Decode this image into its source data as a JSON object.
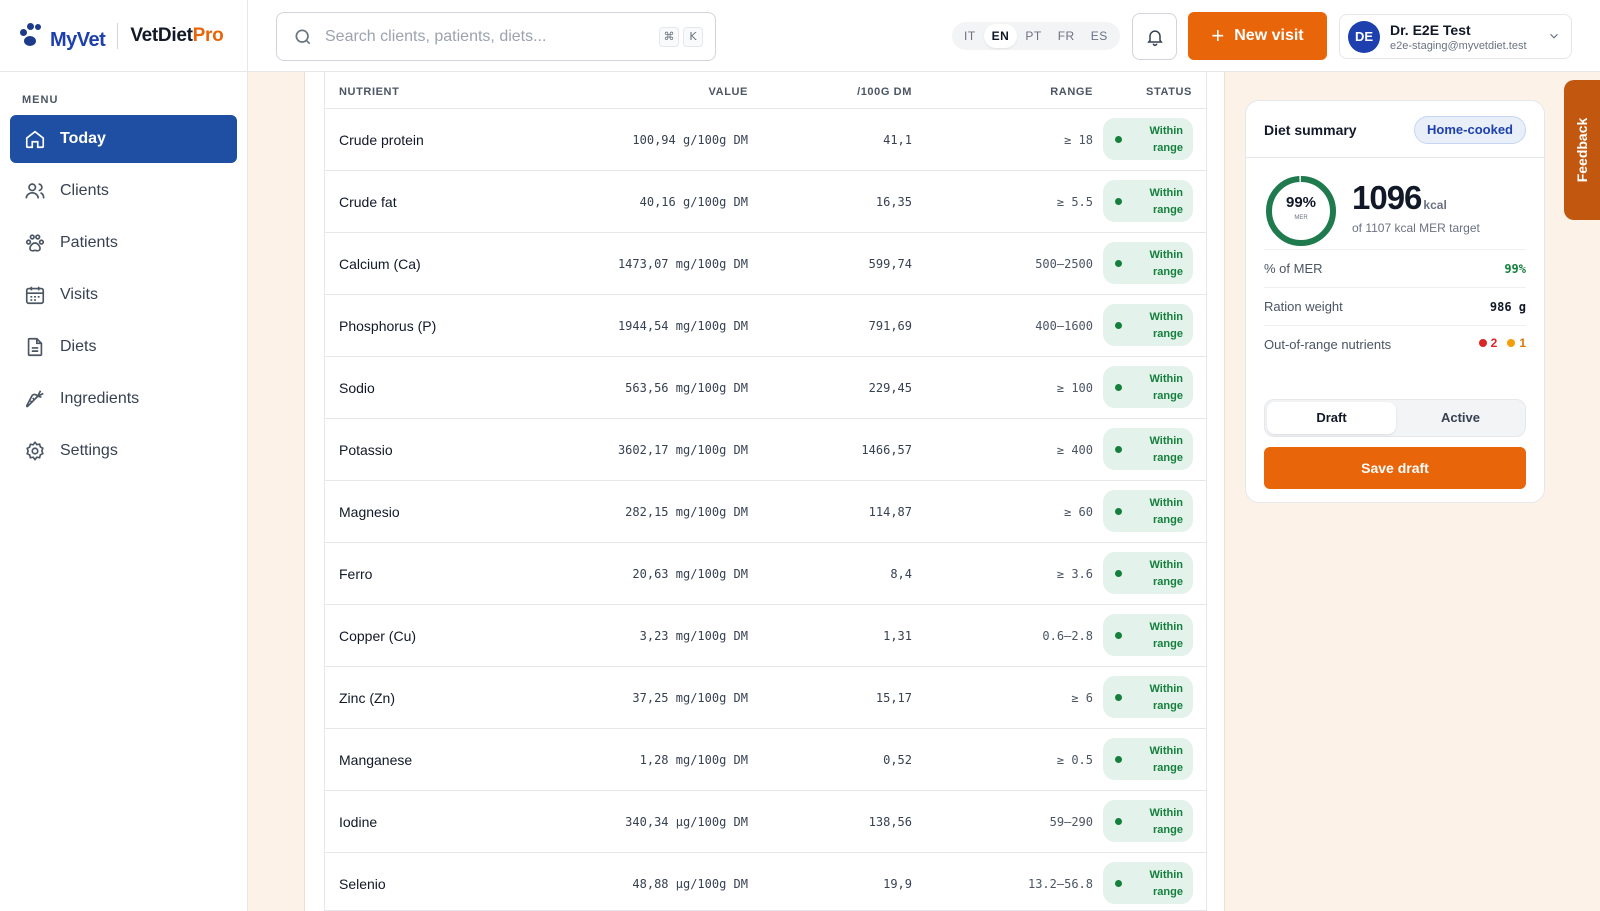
{
  "brand": {
    "logo_text": "MyVet",
    "product_main": "VetDiet",
    "product_accent": "Pro"
  },
  "search": {
    "placeholder": "Search clients, patients, diets...",
    "shortcut_1": "⌘",
    "shortcut_2": "K"
  },
  "languages": [
    {
      "code": "IT",
      "active": false
    },
    {
      "code": "EN",
      "active": true
    },
    {
      "code": "PT",
      "active": false
    },
    {
      "code": "FR",
      "active": false
    },
    {
      "code": "ES",
      "active": false
    }
  ],
  "header": {
    "new_visit_label": "New visit"
  },
  "user": {
    "initials": "DE",
    "name": "Dr. E2E Test",
    "email": "e2e-staging@myvetdiet.test"
  },
  "sidebar": {
    "menu_title": "MENU",
    "items": [
      {
        "label": "Today",
        "icon": "home-icon",
        "active": true
      },
      {
        "label": "Clients",
        "icon": "users-icon",
        "active": false
      },
      {
        "label": "Patients",
        "icon": "paw-icon",
        "active": false
      },
      {
        "label": "Visits",
        "icon": "calendar-icon",
        "active": false
      },
      {
        "label": "Diets",
        "icon": "document-icon",
        "active": false
      },
      {
        "label": "Ingredients",
        "icon": "carrot-icon",
        "active": false
      },
      {
        "label": "Settings",
        "icon": "gear-icon",
        "active": false
      }
    ]
  },
  "table": {
    "headers": {
      "nutrient": "NUTRIENT",
      "value": "VALUE",
      "per_dm": "/100G DM",
      "range": "RANGE",
      "status": "STATUS"
    },
    "rows": [
      {
        "nutrient": "Crude protein",
        "value": "100,94 g/100g DM",
        "dm": "41,1",
        "range": "≥ 18",
        "status_1": "Within",
        "status_2": "range"
      },
      {
        "nutrient": "Crude fat",
        "value": "40,16 g/100g DM",
        "dm": "16,35",
        "range": "≥ 5.5",
        "status_1": "Within",
        "status_2": "range"
      },
      {
        "nutrient": "Calcium (Ca)",
        "value": "1473,07 mg/100g DM",
        "dm": "599,74",
        "range": "500–2500",
        "status_1": "Within",
        "status_2": "range"
      },
      {
        "nutrient": "Phosphorus (P)",
        "value": "1944,54 mg/100g DM",
        "dm": "791,69",
        "range": "400–1600",
        "status_1": "Within",
        "status_2": "range"
      },
      {
        "nutrient": "Sodio",
        "value": "563,56 mg/100g DM",
        "dm": "229,45",
        "range": "≥ 100",
        "status_1": "Within",
        "status_2": "range"
      },
      {
        "nutrient": "Potassio",
        "value": "3602,17 mg/100g DM",
        "dm": "1466,57",
        "range": "≥ 400",
        "status_1": "Within",
        "status_2": "range"
      },
      {
        "nutrient": "Magnesio",
        "value": "282,15 mg/100g DM",
        "dm": "114,87",
        "range": "≥ 60",
        "status_1": "Within",
        "status_2": "range"
      },
      {
        "nutrient": "Ferro",
        "value": "20,63 mg/100g DM",
        "dm": "8,4",
        "range": "≥ 3.6",
        "status_1": "Within",
        "status_2": "range"
      },
      {
        "nutrient": "Copper (Cu)",
        "value": "3,23 mg/100g DM",
        "dm": "1,31",
        "range": "0.6–2.8",
        "status_1": "Within",
        "status_2": "range"
      },
      {
        "nutrient": "Zinc (Zn)",
        "value": "37,25 mg/100g DM",
        "dm": "15,17",
        "range": "≥ 6",
        "status_1": "Within",
        "status_2": "range"
      },
      {
        "nutrient": "Manganese",
        "value": "1,28 mg/100g DM",
        "dm": "0,52",
        "range": "≥ 0.5",
        "status_1": "Within",
        "status_2": "range"
      },
      {
        "nutrient": "Iodine",
        "value": "340,34 µg/100g DM",
        "dm": "138,56",
        "range": "59–290",
        "status_1": "Within",
        "status_2": "range"
      },
      {
        "nutrient": "Selenio",
        "value": "48,88 µg/100g DM",
        "dm": "19,9",
        "range": "13.2–56.8",
        "status_1": "Within",
        "status_2": "range"
      }
    ]
  },
  "summary": {
    "title": "Diet summary",
    "tag": "Home-cooked",
    "ring_percent": "99%",
    "ring_label": "MER",
    "ring_fraction": 0.99,
    "kcal": "1096",
    "kcal_unit": "kcal",
    "kcal_sub": "of 1107 kcal MER target",
    "mer_label": "% of MER",
    "mer_value": "99%",
    "ration_label": "Ration weight",
    "ration_value": "986 g",
    "oor_label": "Out-of-range nutrients",
    "oor_red": "2",
    "oor_orange": "1",
    "toggle_draft": "Draft",
    "toggle_active": "Active",
    "save_label": "Save draft"
  },
  "feedback_label": "Feedback",
  "colors": {
    "accent": "#e8650a",
    "primary": "#1e4fa3",
    "success": "#15803d",
    "ok_bg": "#e3f2ea",
    "error": "#dc2626",
    "warning": "#f59e0b"
  }
}
